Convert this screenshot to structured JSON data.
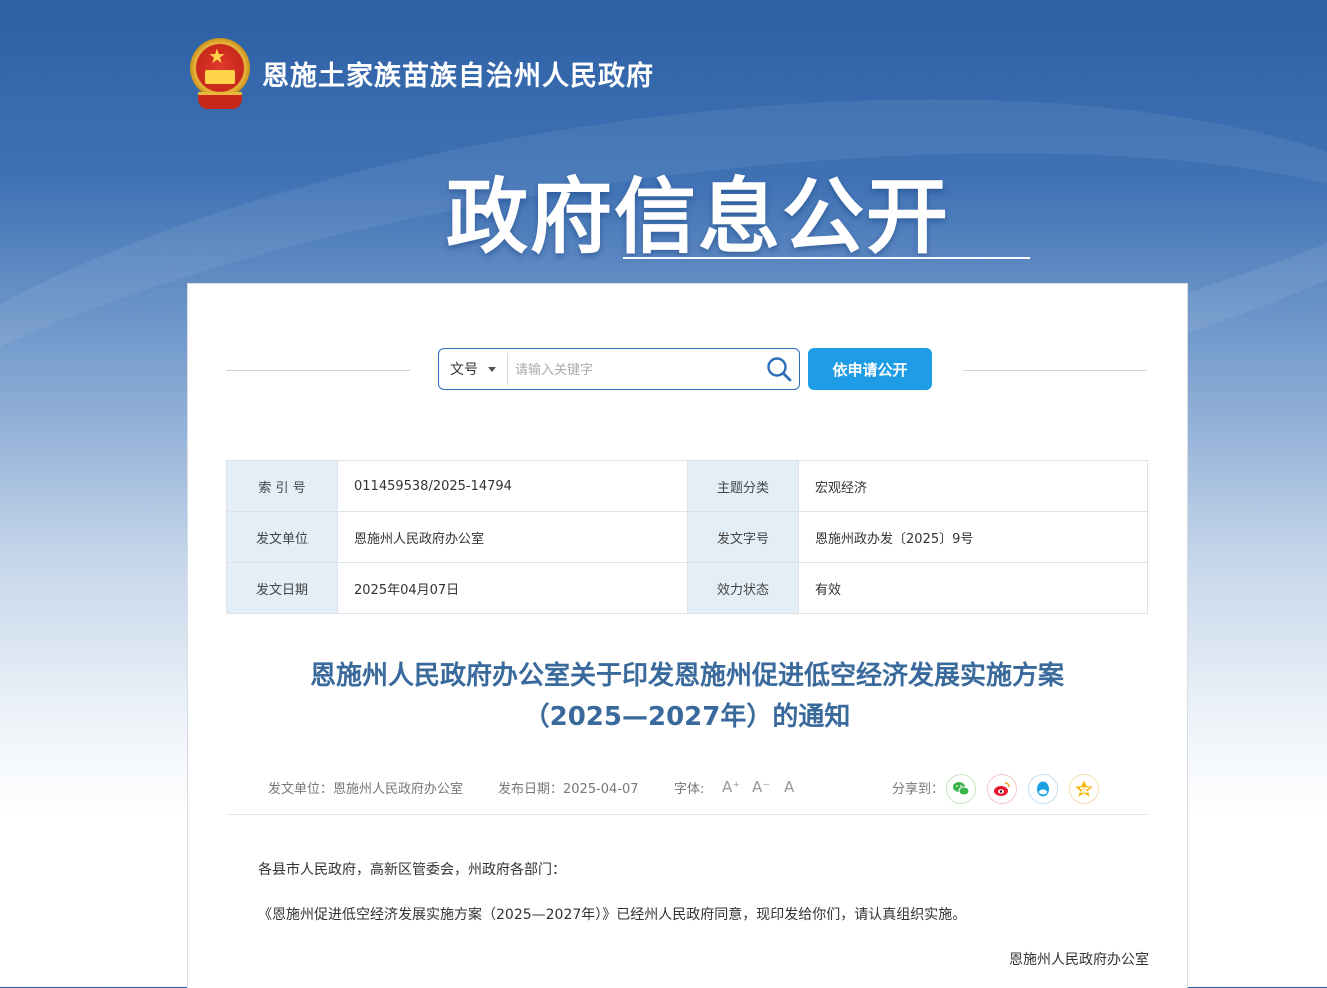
{
  "site": {
    "name": "恩施土家族苗族自治州人民政府",
    "section_title": "政府信息公开"
  },
  "search": {
    "type_label": "文号",
    "placeholder": "请输入关键字",
    "apply_button": "依申请公开"
  },
  "meta": {
    "index_label": "索 引 号",
    "index_value": "011459538/2025-14794",
    "topic_label": "主题分类",
    "topic_value": "宏观经济",
    "unit_label": "发文单位",
    "unit_value": "恩施州人民政府办公室",
    "docno_label": "发文字号",
    "docno_value": "恩施州政办发〔2025〕9号",
    "date_label": "发文日期",
    "date_value": "2025年04月07日",
    "status_label": "效力状态",
    "status_value": "有效"
  },
  "document": {
    "title_line1": "恩施州人民政府办公室关于印发恩施州促进低空经济发展实施方案",
    "title_line2": "（2025—2027年）的通知",
    "info_unit": "发文单位：恩施州人民政府办公室",
    "info_date": "发布日期：2025-04-07",
    "font_label": "字体:",
    "font_large": "A⁺",
    "font_small": "A⁻",
    "font_reset": "A",
    "share_label": "分享到：",
    "salutation": "各县市人民政府，高新区管委会，州政府各部门：",
    "paragraph1": "《恩施州促进低空经济发展实施方案（2025—2027年）》已经州人民政府同意，现印发给你们，请认真组织实施。",
    "signature": "恩施州人民政府办公室"
  },
  "share_icons": [
    "wechat-icon",
    "weibo-icon",
    "qq-icon",
    "qzone-icon"
  ],
  "colors": {
    "accent_blue": "#1e9ce6",
    "title_blue": "#3a6a9c",
    "label_bg": "#e3eef7"
  }
}
